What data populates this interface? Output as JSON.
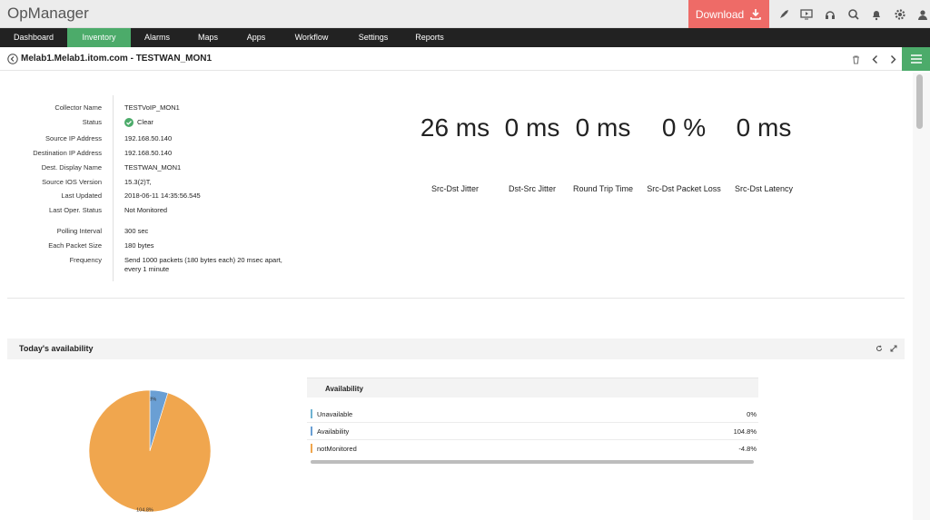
{
  "app": {
    "brand": "OpManager",
    "download_label": "Download"
  },
  "top_icons": [
    "rocket-icon",
    "monitor-play-icon",
    "headset-icon",
    "search-icon",
    "bell-icon",
    "gear-icon",
    "user-icon"
  ],
  "nav": {
    "items": [
      {
        "label": "Dashboard",
        "active": false
      },
      {
        "label": "Inventory",
        "active": true
      },
      {
        "label": "Alarms",
        "active": false
      },
      {
        "label": "Maps",
        "active": false
      },
      {
        "label": "Apps",
        "active": false
      },
      {
        "label": "Workflow",
        "active": false
      },
      {
        "label": "Settings",
        "active": false
      },
      {
        "label": "Reports",
        "active": false
      }
    ]
  },
  "title": "Melab1.Melab1.itom.com - TESTWAN_MON1",
  "details": {
    "collector_name": {
      "label": "Collector Name",
      "value": "TESTVoIP_MON1"
    },
    "status": {
      "label": "Status",
      "value": "Clear"
    },
    "source_ip": {
      "label": "Source IP Address",
      "value": "192.168.50.140"
    },
    "destination_ip": {
      "label": "Destination IP Address",
      "value": "192.168.50.140"
    },
    "dest_display_name": {
      "label": "Dest. Display Name",
      "value": "TESTWAN_MON1"
    },
    "source_ios": {
      "label": "Source IOS Version",
      "value": "15.3(2)T,"
    },
    "last_updated": {
      "label": "Last Updated",
      "value": "2018-06-11 14:35:56.545"
    },
    "last_oper_status": {
      "label": "Last Oper. Status",
      "value": "Not Monitored"
    },
    "polling_interval": {
      "label": "Polling Interval",
      "value": "300 sec"
    },
    "packet_size": {
      "label": "Each Packet Size",
      "value": "180 bytes"
    },
    "frequency": {
      "label": "Frequency",
      "value": "Send 1000 packets (180 bytes each) 20 msec apart, every 1 minute"
    }
  },
  "metrics": [
    {
      "value": "26 ms",
      "label": "Src-Dst Jitter"
    },
    {
      "value": "0 ms",
      "label": "Dst-Src Jitter"
    },
    {
      "value": "0 ms",
      "label": "Round Trip Time"
    },
    {
      "value": "0 %",
      "label": "Src-Dst Packet Loss"
    },
    {
      "value": "0 ms",
      "label": "Src-Dst Latency"
    }
  ],
  "availability": {
    "section_title": "Today's availability",
    "table_title": "Availability",
    "rows": [
      {
        "name": "Unavailable",
        "pct": "0%",
        "color": "#6fb3d2"
      },
      {
        "name": "Availability",
        "pct": "104.8%",
        "color": "#6a9fd4"
      },
      {
        "name": "notMonitored",
        "pct": "-4.8%",
        "color": "#f0a64e"
      }
    ],
    "pie_labels": {
      "small": "4.8%",
      "large": "104.8%"
    }
  },
  "chart_data": {
    "type": "pie",
    "slices": [
      {
        "label": "4.8%",
        "value": 4.8,
        "color": "#6a9fd4"
      },
      {
        "label": "104.8%",
        "value": 95.2,
        "color": "#f0a64e"
      }
    ]
  }
}
